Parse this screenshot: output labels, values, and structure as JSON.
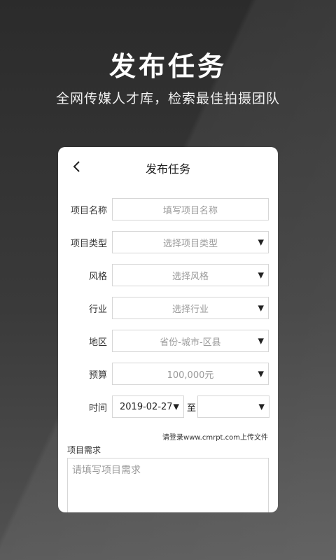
{
  "hero": {
    "title": "发布任务",
    "subtitle": "全网传媒人才库，检索最佳拍摄团队"
  },
  "card": {
    "title": "发布任务",
    "back_icon": "chevron-left-icon",
    "fields": {
      "project_name": {
        "label": "项目名称",
        "placeholder": "填写项目名称"
      },
      "project_type": {
        "label": "项目类型",
        "placeholder": "选择项目类型"
      },
      "style": {
        "label": "风格",
        "placeholder": "选择风格"
      },
      "industry": {
        "label": "行业",
        "placeholder": "选择行业"
      },
      "region": {
        "label": "地区",
        "placeholder": "省份-城市-区县"
      },
      "budget": {
        "label": "预算",
        "value": "100,000元"
      },
      "time": {
        "label": "时间",
        "start": "2019-02-27",
        "to": "至",
        "end": ""
      }
    },
    "upload_note": "请登录www.cmrpt.com上传文件",
    "requirement": {
      "label": "项目需求",
      "placeholder": "请填写项目需求"
    }
  },
  "colors": {
    "background": "#2b2b2b",
    "card": "#ffffff",
    "border": "#d6d6d6",
    "placeholder": "#9a9a9a"
  }
}
